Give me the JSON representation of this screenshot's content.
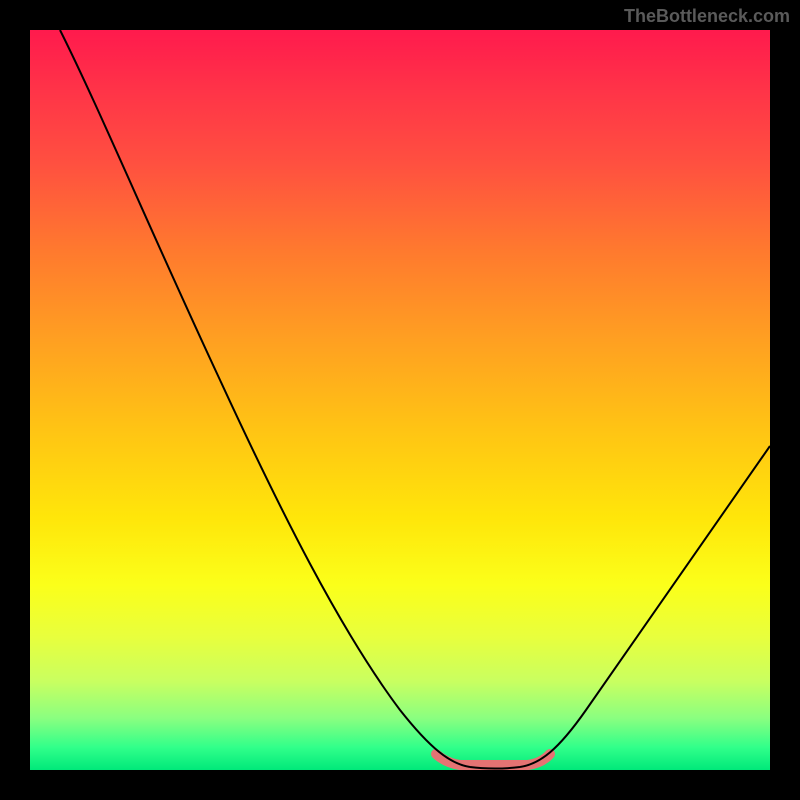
{
  "watermark": "TheBottleneck.com",
  "chart_data": {
    "type": "line",
    "title": "",
    "xlabel": "",
    "ylabel": "",
    "xlim": [
      0,
      100
    ],
    "ylim": [
      0,
      100
    ],
    "grid": false,
    "legend": false,
    "background_gradient_stops": [
      {
        "offset": 0,
        "color": "#ff1a4d"
      },
      {
        "offset": 100,
        "color": "#00e97a"
      }
    ],
    "series": [
      {
        "name": "left-curve",
        "x": [
          4,
          10,
          18,
          26,
          34,
          42,
          48,
          52,
          55,
          57,
          59
        ],
        "y": [
          100,
          87,
          68,
          49,
          32,
          17,
          8,
          3.5,
          1.5,
          0.6,
          0.2
        ]
      },
      {
        "name": "right-curve",
        "x": [
          68,
          70,
          74,
          80,
          88,
          96,
          100
        ],
        "y": [
          0.2,
          1,
          4,
          11,
          23,
          37,
          44
        ]
      },
      {
        "name": "valley-floor-highlight",
        "x": [
          55,
          57,
          59,
          62,
          65,
          68,
          70
        ],
        "y": [
          1.5,
          0.6,
          0.2,
          0.1,
          0.2,
          0.4,
          1
        ]
      }
    ],
    "annotations": []
  }
}
